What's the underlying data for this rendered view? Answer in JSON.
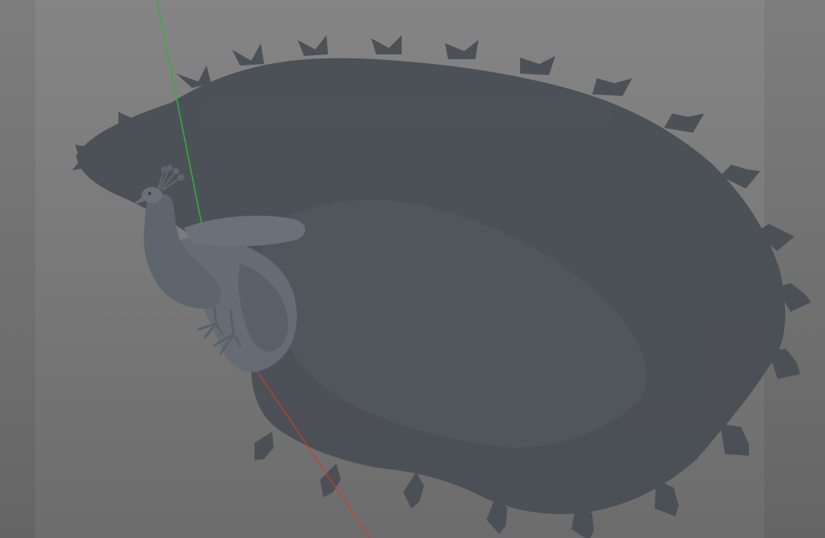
{
  "viewport": {
    "title": "",
    "render_mode": "solid-shaded",
    "colors": {
      "background_top": "#858585",
      "background_bottom": "#6c6c6c",
      "model_shadow": "#4a4f55",
      "model_body": "#5e646b",
      "axis_y": "#2fb43a",
      "axis_x": "#d23a2a"
    }
  },
  "scene": {
    "model": "peacock-model",
    "shadow": "tail-fan-shadow",
    "axes": [
      "x-axis",
      "y-axis"
    ]
  }
}
